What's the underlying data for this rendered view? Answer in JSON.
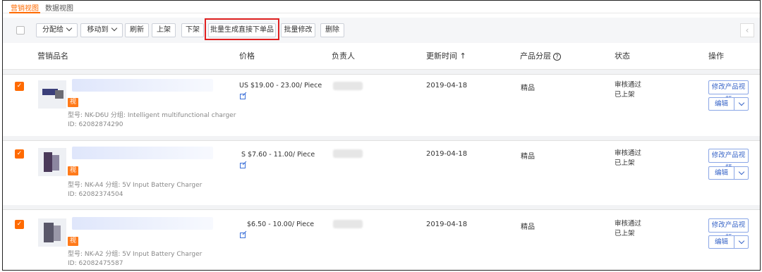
{
  "tabs": {
    "marketing_view": "营销视图",
    "data_view": "数据视图"
  },
  "toolbar": {
    "assign": "分配给",
    "move_to": "移动到",
    "refresh": "刷新",
    "publish": "上架",
    "unpublish": "下架",
    "batch_generate": "批量生成直接下单品",
    "batch_modify": "批量修改",
    "delete": "删除",
    "nav_prev": "‹"
  },
  "table": {
    "headers": {
      "product_name": "营销品名",
      "price": "价格",
      "owner": "负责人",
      "updated": "更新时间",
      "sort_mark": "↑",
      "tier": "产品分层",
      "tier_help": "?",
      "status": "状态",
      "actions": "操作"
    },
    "rows": [
      {
        "badge": "视",
        "model": "型号: NK-D6U  分组: Intelligent multifunctional charger",
        "id": "ID: 62082874290",
        "price": "US $19.00 - 23.00/ Piece",
        "updated": "2019-04-18",
        "tier": "精品",
        "status_line1": "审核通过",
        "status_line2": "已上架",
        "modify_video": "修改产品视频",
        "edit": "编辑"
      },
      {
        "badge": "视",
        "model": "型号: NK-A4  分组: 5V Input Battery Charger",
        "id": "ID: 62082374504",
        "price": "S $7.60 - 11.00/ Piece",
        "updated": "2019-04-18",
        "tier": "精品",
        "status_line1": "审核通过",
        "status_line2": "已上架",
        "modify_video": "修改产品视频",
        "edit": "编辑"
      },
      {
        "badge": "视",
        "model": "型号: NK-A2  分组: 5V Input Battery Charger",
        "id": "ID: 62082475587",
        "price": "$6.50 - 10.00/ Piece",
        "updated": "2019-04-18",
        "tier": "精品",
        "status_line1": "审核通过",
        "status_line2": "已上架",
        "modify_video": "修改产品视频",
        "edit": "编辑"
      }
    ]
  },
  "colors": {
    "accent": "#ff6a00",
    "highlight": "#e02020",
    "link": "#3a66c8"
  }
}
